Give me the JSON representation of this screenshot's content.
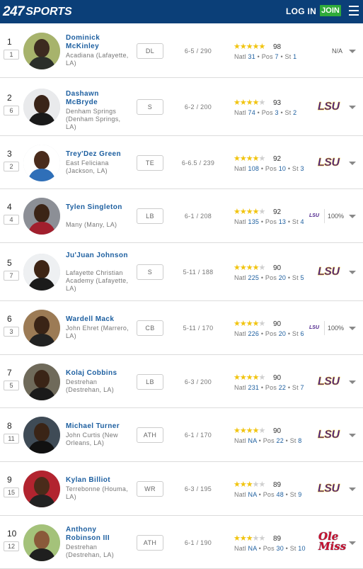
{
  "header": {
    "logo_text_a": "24",
    "logo_text_b": "7",
    "logo_text_c": "SPORTS",
    "login_label": "LOG IN",
    "join_label": "JOIN",
    "menu_icon": "hamburger-icon"
  },
  "colors": {
    "header_bg": "#0b3f78",
    "join_bg": "#2faa3a",
    "name_link": "#1d5fa0",
    "star": "#f1c40f",
    "lsu_purple": "#4a1f8a",
    "olemiss_red": "#c8102e"
  },
  "players": [
    {
      "rank": "1",
      "rank_box": "1",
      "name": "Dominick McKinley",
      "school": "Acadiana (Lafayette, LA)",
      "pos": "DL",
      "htwt": "6-5 / 290",
      "stars": 5,
      "rating": "98",
      "natl": "31",
      "posrank": "7",
      "st": "1",
      "pick": "N/A",
      "pick_type": "na"
    },
    {
      "rank": "2",
      "rank_box": "6",
      "name": "Dashawn McBryde",
      "school": "Denham Springs (Denham Springs, LA)",
      "pos": "S",
      "htwt": "6-2 / 200",
      "stars": 4,
      "rating": "93",
      "natl": "74",
      "posrank": "3",
      "st": "2",
      "pick": "LSU",
      "pick_type": "lsu"
    },
    {
      "rank": "3",
      "rank_box": "2",
      "name": "Trey'Dez Green",
      "school": "East Feliciana (Jackson, LA)",
      "pos": "TE",
      "htwt": "6-6.5 / 239",
      "stars": 4,
      "rating": "92",
      "natl": "108",
      "posrank": "10",
      "st": "3",
      "pick": "LSU",
      "pick_type": "lsu"
    },
    {
      "rank": "4",
      "rank_box": "4",
      "name": "Tylen Singleton",
      "school": "Many (Many, LA)",
      "pos": "LB",
      "htwt": "6-1 / 208",
      "stars": 4,
      "rating": "92",
      "natl": "135",
      "posrank": "13",
      "st": "4",
      "pick": "100%",
      "pick_logo": "LSU",
      "pick_type": "pct"
    },
    {
      "rank": "5",
      "rank_box": "7",
      "name": "Ju'Juan Johnson",
      "school": "Lafayette Christian Academy (Lafayette, LA)",
      "pos": "S",
      "htwt": "5-11 / 188",
      "stars": 4,
      "rating": "90",
      "natl": "225",
      "posrank": "20",
      "st": "5",
      "pick": "LSU",
      "pick_type": "lsu"
    },
    {
      "rank": "6",
      "rank_box": "3",
      "name": "Wardell Mack",
      "school": "John Ehret (Marrero, LA)",
      "pos": "CB",
      "htwt": "5-11 / 170",
      "stars": 4,
      "rating": "90",
      "natl": "226",
      "posrank": "20",
      "st": "6",
      "pick": "100%",
      "pick_logo": "LSU",
      "pick_type": "pct"
    },
    {
      "rank": "7",
      "rank_box": "5",
      "name": "Kolaj Cobbins",
      "school": "Destrehan (Destrehan, LA)",
      "pos": "LB",
      "htwt": "6-3 / 200",
      "stars": 4,
      "rating": "90",
      "natl": "231",
      "posrank": "22",
      "st": "7",
      "pick": "LSU",
      "pick_type": "lsu"
    },
    {
      "rank": "8",
      "rank_box": "11",
      "name": "Michael Turner",
      "school": "John Curtis (New Orleans, LA)",
      "pos": "ATH",
      "htwt": "6-1 / 170",
      "stars": 4,
      "rating": "90",
      "natl": "NA",
      "posrank": "22",
      "st": "8",
      "pick": "LSU",
      "pick_type": "lsu"
    },
    {
      "rank": "9",
      "rank_box": "15",
      "name": "Kylan Billiot",
      "school": "Terrebonne (Houma, LA)",
      "pos": "WR",
      "htwt": "6-3 / 195",
      "stars": 3,
      "rating": "89",
      "natl": "NA",
      "posrank": "48",
      "st": "9",
      "pick": "LSU",
      "pick_type": "lsu"
    },
    {
      "rank": "10",
      "rank_box": "12",
      "name": "Anthony Robinson III",
      "school": "Destrehan (Destrehan, LA)",
      "pos": "ATH",
      "htwt": "6-1 / 190",
      "stars": 3,
      "rating": "89",
      "natl": "NA",
      "posrank": "30",
      "st": "10",
      "pick": "Ole Miss",
      "pick_type": "olemiss"
    }
  ],
  "labels": {
    "natl": "Natl",
    "pos": "Pos",
    "st": "St",
    "sep": "•"
  }
}
